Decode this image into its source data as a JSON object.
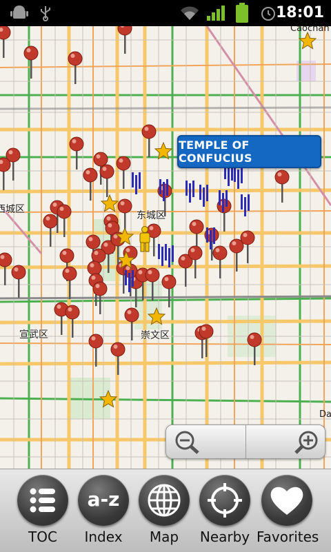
{
  "status_bar": {
    "time": "18:01",
    "icons": [
      "android-debug-icon",
      "usb-icon",
      "wifi-icon",
      "signal-icon",
      "battery-icon",
      "alarm-icon"
    ]
  },
  "map": {
    "callout": "TEMPLE OF CONFUCIUS",
    "districts": [
      "东城区",
      "宣武区",
      "崇文区",
      "西城区"
    ],
    "edge_labels": [
      "Caochan",
      "Da"
    ],
    "zoom_out_icon": "zoom-out-icon",
    "zoom_in_icon": "zoom-in-icon",
    "colors": {
      "pin": "#c0392b",
      "star": "#f2b705",
      "fork": "#2b2bb8",
      "callout": "#1468c2",
      "road_major": "#f6c86a",
      "road_green": "#4caf50"
    }
  },
  "bottom_nav": {
    "items": [
      {
        "label": "TOC",
        "icon": "list-icon"
      },
      {
        "label": "Index",
        "icon": "az-icon"
      },
      {
        "label": "Map",
        "icon": "globe-icon"
      },
      {
        "label": "Nearby",
        "icon": "crosshair-icon"
      },
      {
        "label": "Favorites",
        "icon": "heart-icon"
      }
    ]
  }
}
